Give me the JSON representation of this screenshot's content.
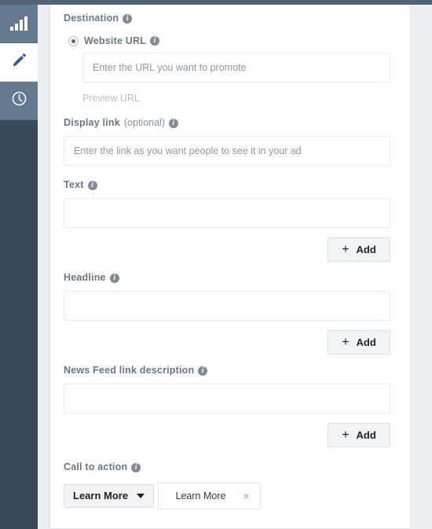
{
  "sidebar": {
    "items": [
      {
        "icon": "bar-chart-icon",
        "name": "sidebar-item-insights",
        "active": false
      },
      {
        "icon": "pencil-icon",
        "name": "sidebar-item-edit",
        "active": true
      },
      {
        "icon": "clock-icon",
        "name": "sidebar-item-history",
        "active": false
      }
    ]
  },
  "form": {
    "destination": {
      "label": "Destination",
      "info": "info-icon",
      "radio_options": [
        {
          "label": "Website URL",
          "selected": true
        }
      ],
      "url_input": {
        "value": "",
        "placeholder": "Enter the URL you want to promote"
      },
      "preview_link": "Preview URL"
    },
    "display_link": {
      "label": "Display link",
      "optional": "(optional)",
      "input": {
        "value": "",
        "placeholder": "Enter the link as you want people to see it in your ad"
      }
    },
    "text": {
      "label": "Text",
      "input": {
        "value": "",
        "placeholder": ""
      },
      "add_label": "Add",
      "add_plus": "+"
    },
    "headline": {
      "label": "Headline",
      "input": {
        "value": "",
        "placeholder": ""
      },
      "add_label": "Add",
      "add_plus": "+"
    },
    "news_feed_link_description": {
      "label": "News Feed link description",
      "input": {
        "value": "",
        "placeholder": ""
      },
      "add_label": "Add",
      "add_plus": "+"
    },
    "call_to_action": {
      "label": "Call to action",
      "selected": "Learn More",
      "token": {
        "label": "Learn More",
        "remove": "×"
      }
    }
  },
  "colors": {
    "topbar": "#546276",
    "rail_dark": "#3b4a5a",
    "rail_tile": "#64788f",
    "accent_blue": "#3b5998",
    "label_gray": "#6a7684",
    "page_bg": "#eceef1"
  }
}
